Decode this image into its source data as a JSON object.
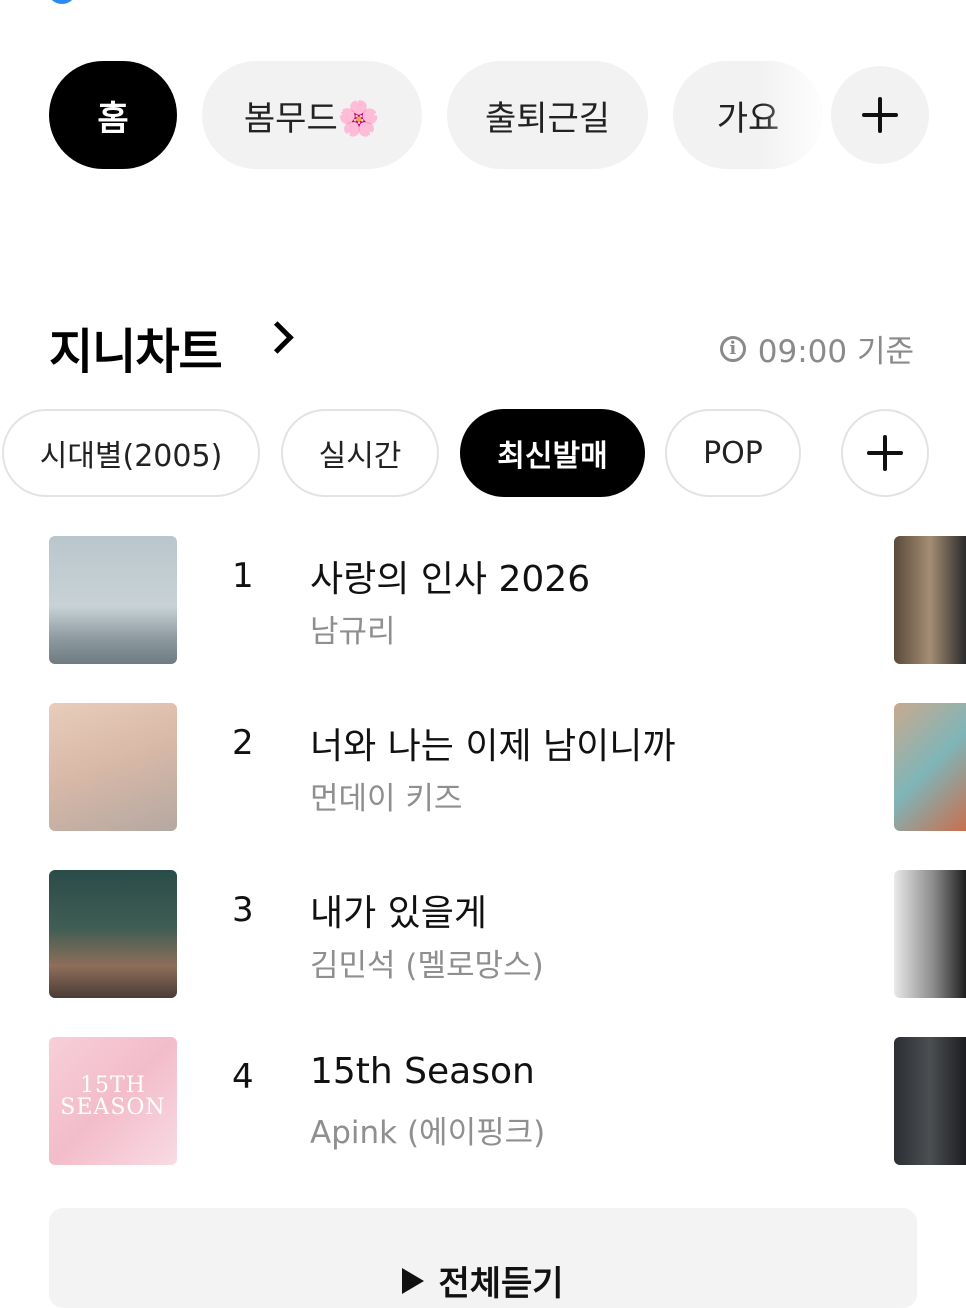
{
  "top_tabs": {
    "home": "홈",
    "spring_mood": "봄무드🌸",
    "commute": "출퇴근길",
    "kpop": "가요"
  },
  "chart_section": {
    "title": "지니차트",
    "updated": "09:00 기준"
  },
  "chips": {
    "era": "시대별(2005)",
    "realtime": "실시간",
    "new_release": "최신발매",
    "pop": "POP"
  },
  "chart": [
    {
      "rank": "1",
      "title": "사랑의 인사 2026",
      "artist": "남규리"
    },
    {
      "rank": "2",
      "title": "너와 나는 이제 남이니까",
      "artist": "먼데이 키즈"
    },
    {
      "rank": "3",
      "title": "내가 있을게",
      "artist": "김민석 (멜로망스)"
    },
    {
      "rank": "4",
      "title": "15th Season",
      "artist": "Apink (에이핑크)"
    }
  ],
  "covers": {
    "cover4_text": "15TH SEASON"
  },
  "play_all": "전체듣기",
  "colors": {
    "active_bg": "#000000",
    "pill_bg": "#f2f2f2",
    "meta_gray": "#8a8a8a"
  }
}
